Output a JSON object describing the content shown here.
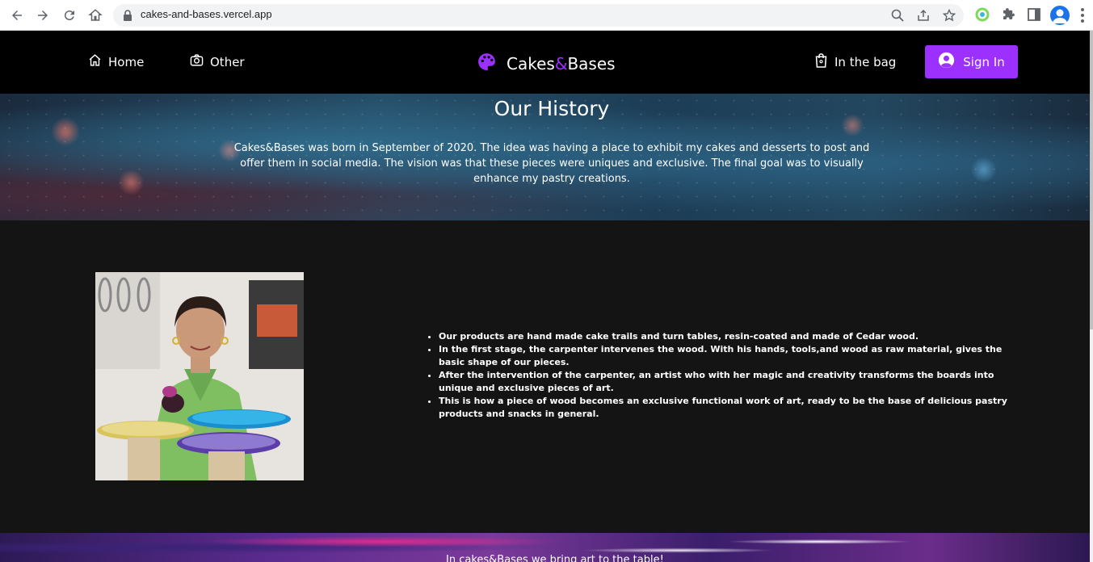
{
  "browser": {
    "url": "cakes-and-bases.vercel.app"
  },
  "header": {
    "nav": [
      {
        "label": "Home",
        "icon": "home-icon"
      },
      {
        "label": "Other",
        "icon": "camera-icon"
      }
    ],
    "brand": {
      "prefix": "Cakes",
      "amp": "&",
      "suffix": "Bases",
      "icon": "palette-icon"
    },
    "bag_label": "In the bag",
    "signin_label": "Sign In",
    "accent_color": "#9b30ff"
  },
  "hero": {
    "title": "Our History",
    "text": "Cakes&Bases was born in September of 2020. The idea was having a place to exhibit my cakes and desserts to post and offer them in social media. The vision was that these pieces were uniques and exclusive. The final goal was to visually enhance my pastry creations."
  },
  "features": [
    "Our products are hand made cake trails and turn tables, resin-coated and made of Cedar wood.",
    "In the first stage, the carpenter intervenes the wood. With his hands, tools,and wood as raw material, gives the basic shape of our pieces.",
    "After the intervention of the carpenter, an artist who with her magic and creativity transforms the boards into unique and exclusive pieces of art.",
    "This is how a piece of wood becomes an exclusive functional work of art, ready to be the base of delicious pastry products and snacks in general."
  ],
  "banner": {
    "text": "In cakes&Bases we bring art to the table!"
  }
}
